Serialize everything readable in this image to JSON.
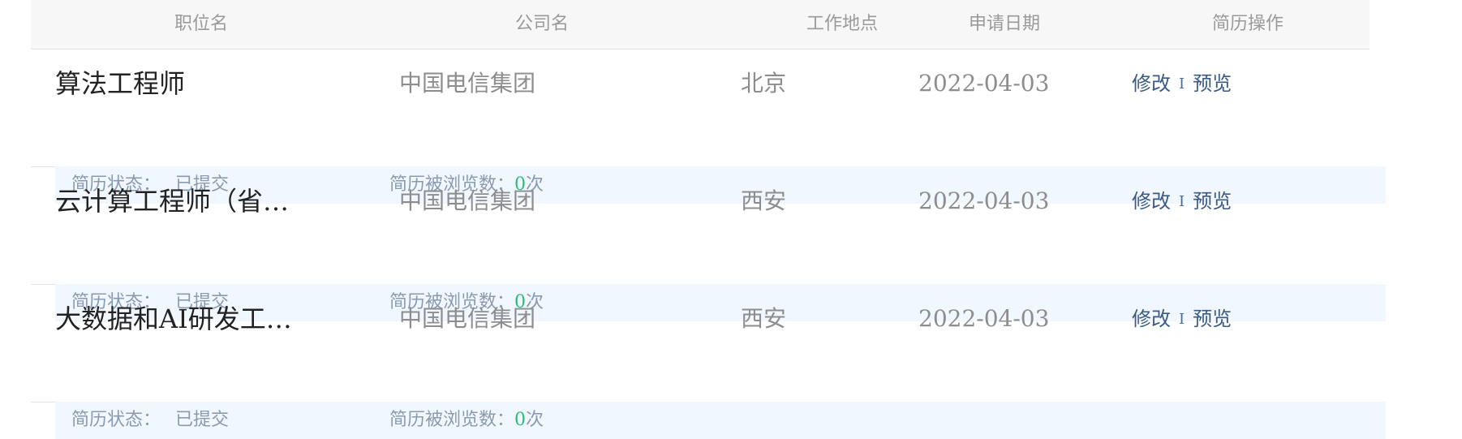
{
  "headers": {
    "position": "职位名",
    "company": "公司名",
    "location": "工作地点",
    "date": "申请日期",
    "actions": "简历操作"
  },
  "rows": [
    {
      "title": "算法工程师",
      "company": "中国电信集团",
      "city": "北京",
      "date": "2022-04-03",
      "edit": "修改",
      "sep": "I",
      "preview": "预览",
      "status_label": "简历状态：",
      "status_value": "已提交",
      "views_label": "简历被浏览数：",
      "views_count": "0",
      "views_unit": "次"
    },
    {
      "title": "云计算工程师（省…",
      "company": "中国电信集团",
      "city": "西安",
      "date": "2022-04-03",
      "edit": "修改",
      "sep": "I",
      "preview": "预览",
      "status_label": "简历状态：",
      "status_value": "已提交",
      "views_label": "简历被浏览数：",
      "views_count": "0",
      "views_unit": "次"
    },
    {
      "title": "大数据和AI研发工…",
      "company": "中国电信集团",
      "city": "西安",
      "date": "2022-04-03",
      "edit": "修改",
      "sep": "I",
      "preview": "预览",
      "status_label": "简历状态：",
      "status_value": "已提交",
      "views_label": "简历被浏览数：",
      "views_count": "0",
      "views_unit": "次"
    }
  ],
  "colors": {
    "link": "#3a5a85",
    "count": "#2bbd78",
    "status_bg": "#f1f7fe",
    "header_bg": "#f7f7f7"
  }
}
